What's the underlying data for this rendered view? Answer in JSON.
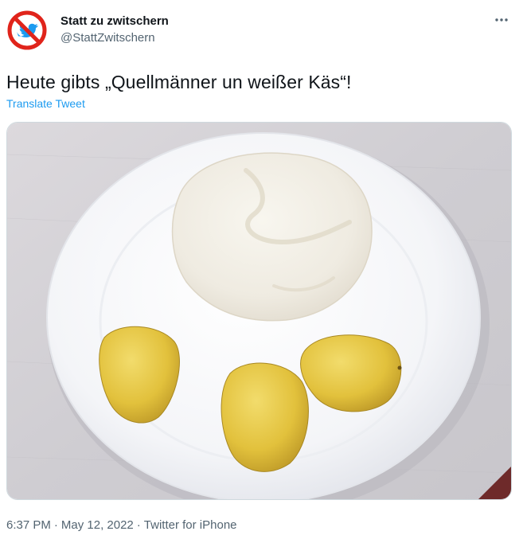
{
  "author": {
    "display_name": "Statt zu zwitschern",
    "handle": "@StattZwitschern",
    "avatar_icon": "no-twitter-bird-icon"
  },
  "tweet": {
    "text": "Heute gibts „Quellmänner un weißer Käs“!",
    "translate_label": "Translate Tweet"
  },
  "meta": {
    "time": "6:37 PM",
    "separator": "·",
    "date": "May 12, 2022",
    "source": "Twitter for iPhone"
  },
  "colors": {
    "accent": "#1d9bf0",
    "secondary_text": "#536471",
    "avatar_red": "#e0241b"
  },
  "icons": {
    "more": "more-horizontal-icon"
  }
}
